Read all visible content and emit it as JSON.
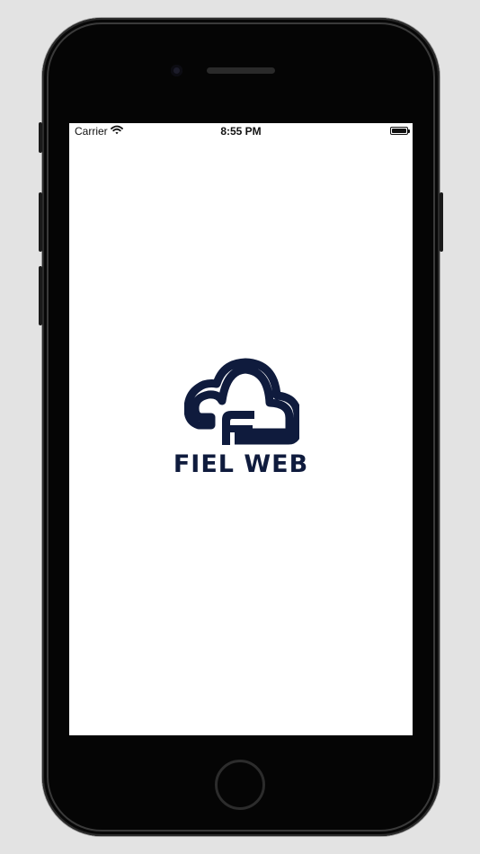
{
  "status_bar": {
    "carrier": "Carrier",
    "time": "8:55 PM",
    "wifi_icon": "wifi-icon",
    "battery_icon": "battery-icon",
    "battery_level": 1.0
  },
  "splash": {
    "logo_icon": "cloud-f-logo",
    "brand_name": "FIEL WEB",
    "brand_color": "#0f1b3d"
  },
  "device": {
    "frame_color": "#050505",
    "background_color": "#e3e3e3"
  }
}
